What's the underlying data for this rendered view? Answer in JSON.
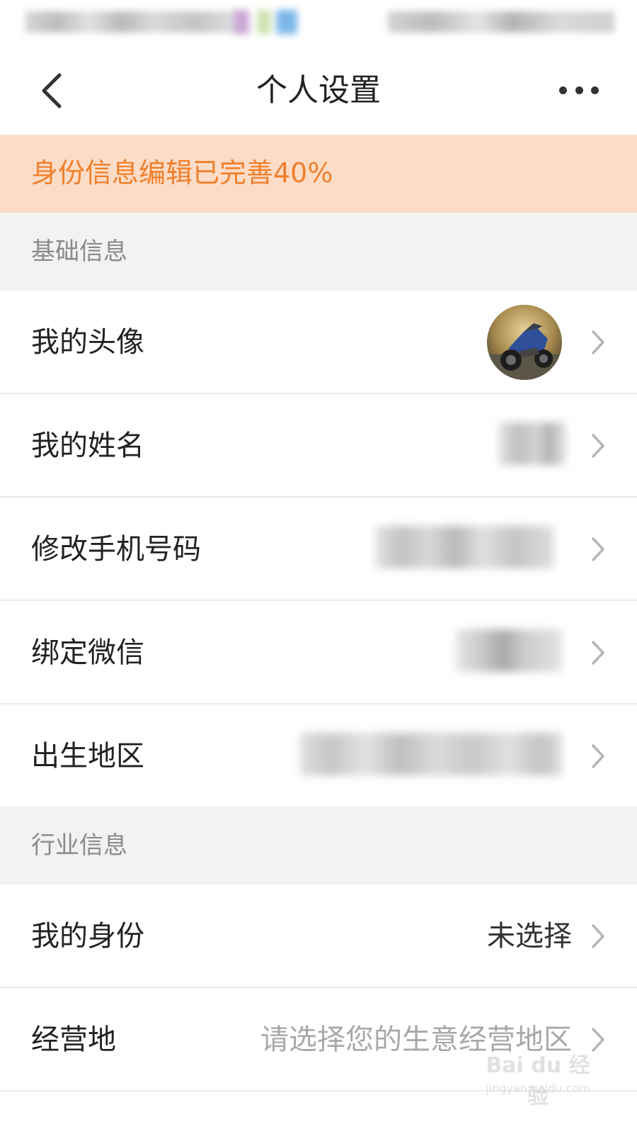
{
  "nav": {
    "title": "个人设置"
  },
  "banner": {
    "text": "身份信息编辑已完善40%",
    "percent_complete": 40
  },
  "sections": {
    "basic": {
      "title": "基础信息",
      "rows": {
        "avatar": {
          "label": "我的头像"
        },
        "name": {
          "label": "我的姓名"
        },
        "phone": {
          "label": "修改手机号码"
        },
        "wechat": {
          "label": "绑定微信"
        },
        "birthplace": {
          "label": "出生地区"
        }
      }
    },
    "industry": {
      "title": "行业信息",
      "rows": {
        "identity": {
          "label": "我的身份",
          "value": "未选择"
        },
        "business_location": {
          "label": "经营地",
          "placeholder": "请选择您的生意经营地区"
        }
      }
    }
  },
  "watermark": {
    "logo_text": "Bai du 经验",
    "url_text": "jingyan.baidu.com"
  },
  "colors": {
    "accent": "#f07f2b",
    "banner_bg": "#fcdcc6",
    "section_bg": "#f2f2f2",
    "placeholder": "#a8a8a8"
  },
  "icons": {
    "back": "chevron-left-icon",
    "more": "more-dots-icon",
    "row_arrow": "chevron-right-icon"
  }
}
